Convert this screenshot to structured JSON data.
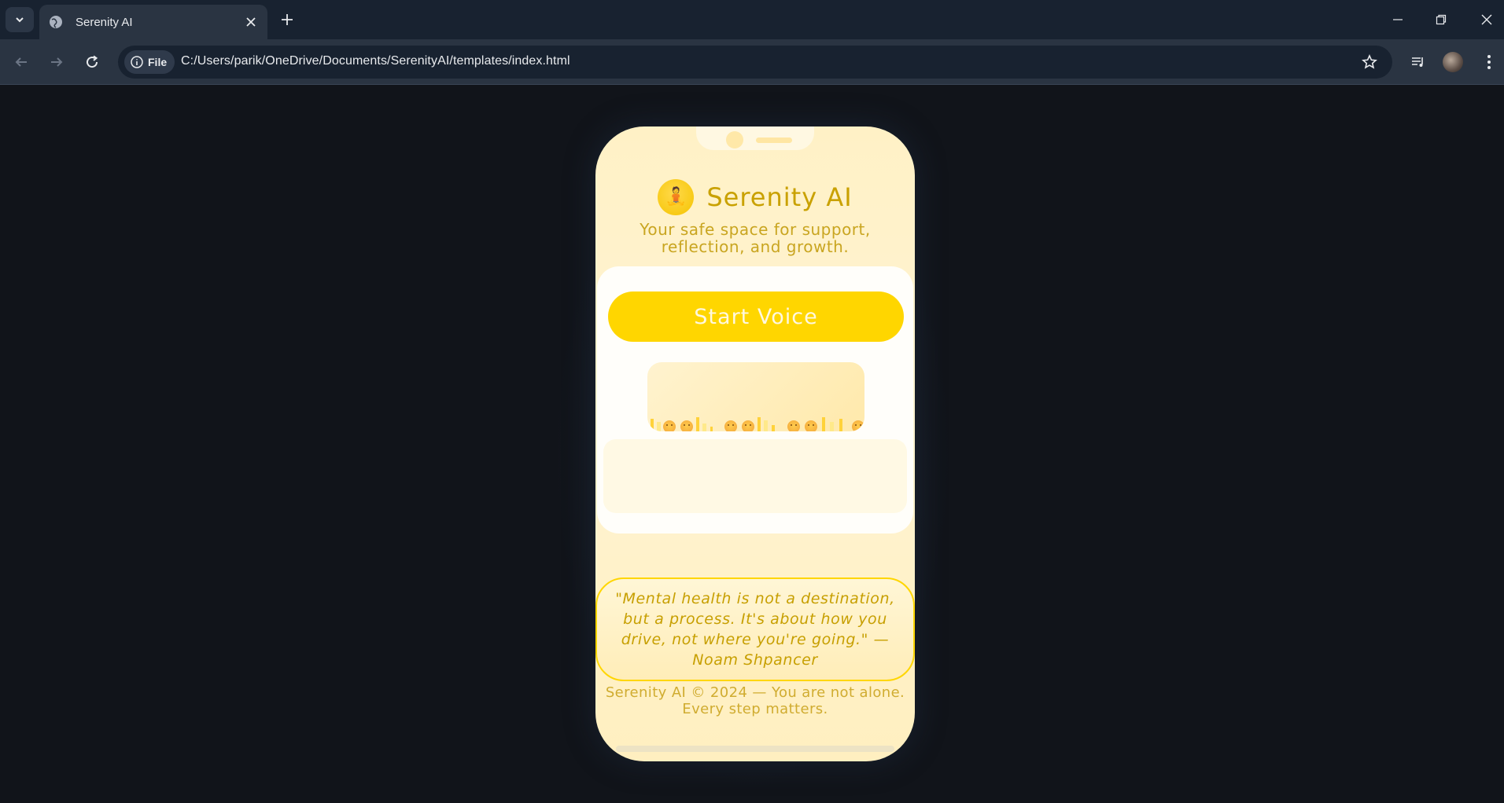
{
  "browser": {
    "tab_title": "Serenity AI",
    "site_chip": "File",
    "url": "C:/Users/parik/OneDrive/Documents/SerenityAI/templates/index.html"
  },
  "app": {
    "logo_emoji": "🧘",
    "title": "Serenity AI",
    "tagline": "Your safe space for support, reflection, and growth.",
    "start_button": "Start Voice",
    "quote": "\"Mental health is not a destination, but a process. It's about how you drive, not where you're going.\" — Noam Shpancer",
    "footer": "Serenity AI © 2024 — You are not alone. Every step matters."
  },
  "colors": {
    "accent": "#ffd600",
    "text_gold": "#c9a100",
    "phone_bg": "#fff1c6",
    "page_bg": "#11141a"
  }
}
